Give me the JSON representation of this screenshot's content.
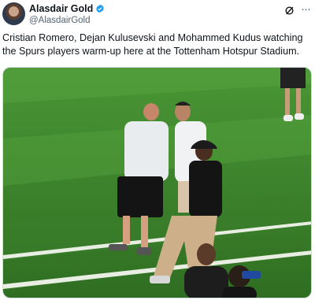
{
  "tweet": {
    "display_name": "Alasdair Gold",
    "handle": "@AlasdairGold",
    "verified": true,
    "text": "Cristian Romero, Dejan Kulusevski and Mohammed Kudus watching the Spurs players warm-up here at the Tottenham Hotspur Stadium.",
    "media_description": "photo"
  },
  "icons": {
    "verified": "verified-badge-icon",
    "grok": "grok-icon",
    "more": "more-options-icon"
  },
  "colors": {
    "verified_blue": "#1d9bf0",
    "text_primary": "#0f1419",
    "text_secondary": "#536471",
    "pitch_green": "#3f8a2c"
  }
}
